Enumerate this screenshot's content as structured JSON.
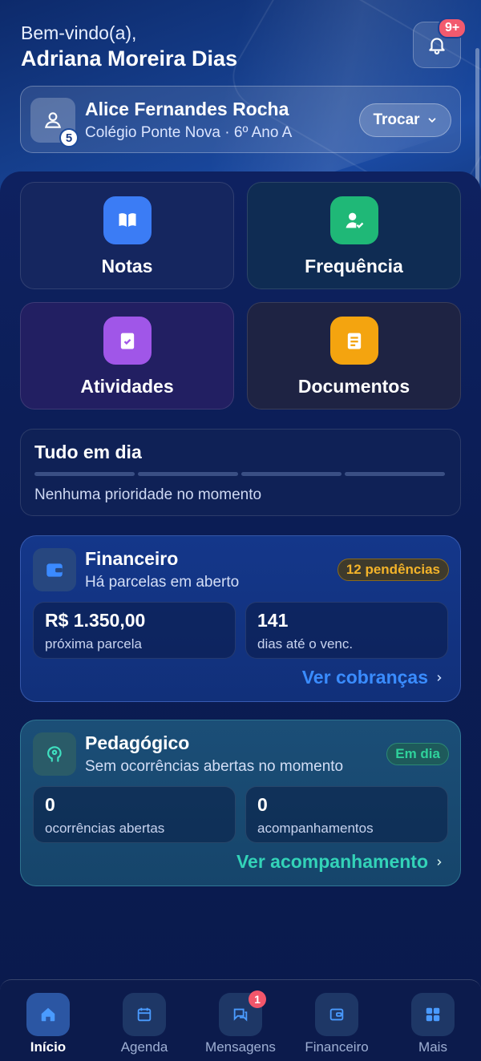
{
  "header": {
    "welcome": "Bem-vindo(a),",
    "user_name": "Adriana Moreira Dias",
    "notifications_badge": "9+"
  },
  "student": {
    "name": "Alice Fernandes Rocha",
    "school": "Colégio Ponte Nova · 6º Ano A",
    "count_badge": "5",
    "switch_label": "Trocar"
  },
  "tiles": [
    {
      "label": "Notas",
      "icon": "book-icon",
      "color": "#3b7cf5"
    },
    {
      "label": "Frequência",
      "icon": "user-check-icon",
      "color": "#1fb877"
    },
    {
      "label": "Atividades",
      "icon": "clipboard-check-icon",
      "color": "#a056e8"
    },
    {
      "label": "Documentos",
      "icon": "document-icon",
      "color": "#f4a40f"
    }
  ],
  "status": {
    "title": "Tudo em dia",
    "subtitle": "Nenhuma prioridade no momento"
  },
  "financeiro": {
    "title": "Financeiro",
    "subtitle": "Há parcelas em aberto",
    "badge": "12 pendências",
    "metric1_value": "R$ 1.350,00",
    "metric1_label": "próxima parcela",
    "metric2_value": "141",
    "metric2_label": "dias até o venc.",
    "link": "Ver cobranças",
    "icon": "wallet-icon"
  },
  "pedagogico": {
    "title": "Pedagógico",
    "subtitle": "Sem ocorrências abertas no momento",
    "badge": "Em dia",
    "metric1_value": "0",
    "metric1_label": "ocorrências abertas",
    "metric2_value": "0",
    "metric2_label": "acompanhamentos",
    "link": "Ver acompanhamento",
    "icon": "brain-icon"
  },
  "nav": [
    {
      "label": "Início",
      "icon": "home-icon",
      "active": true
    },
    {
      "label": "Agenda",
      "icon": "calendar-icon"
    },
    {
      "label": "Mensagens",
      "icon": "chat-icon",
      "badge": "1"
    },
    {
      "label": "Financeiro",
      "icon": "wallet-icon"
    },
    {
      "label": "Mais",
      "icon": "grid-icon"
    }
  ]
}
